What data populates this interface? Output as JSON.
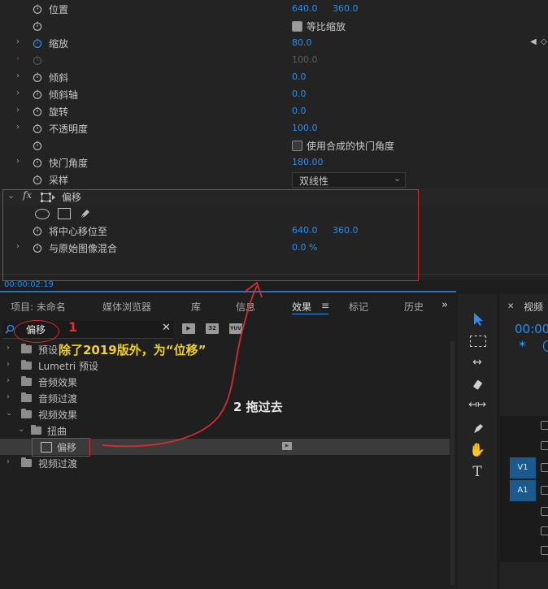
{
  "effect_controls": {
    "params": [
      {
        "name": "位置",
        "v1": "640.0",
        "v2": "360.0"
      },
      {
        "checkbox_label": "等比缩放"
      },
      {
        "name": "缩放",
        "v1": "80.0"
      },
      {
        "v1": "100.0"
      },
      {
        "name": "倾斜",
        "v1": "0.0"
      },
      {
        "name": "倾斜轴",
        "v1": "0.0"
      },
      {
        "name": "旋转",
        "v1": "0.0"
      },
      {
        "name": "不透明度",
        "v1": "100.0"
      },
      {
        "checkbox_label": "使用合成的快门角度"
      },
      {
        "name": "快门角度",
        "v1": "180.00"
      },
      {
        "name": "采样",
        "select_value": "双线性"
      }
    ],
    "offset_effect": {
      "fx_label": "fx",
      "name": "偏移",
      "params": [
        {
          "name": "将中心移位至",
          "v1": "640.0",
          "v2": "360.0"
        },
        {
          "name": "与原始图像混合",
          "v1": "0.0 %"
        }
      ]
    },
    "timecode": "00:00:02:19"
  },
  "effects_panel": {
    "tabs": [
      "项目: 未命名",
      "媒体浏览器",
      "库",
      "信息",
      "效果",
      "标记",
      "历史"
    ],
    "overflow": "»",
    "search_value": "偏移",
    "badges": [
      "32",
      "YUV"
    ],
    "tree": [
      {
        "label": "预设"
      },
      {
        "label": "Lumetri 预设"
      },
      {
        "label": "音频效果"
      },
      {
        "label": "音频过渡"
      },
      {
        "label": "视频效果"
      },
      {
        "label": "扭曲"
      },
      {
        "label": "偏移"
      },
      {
        "label": "视频过渡"
      }
    ]
  },
  "timeline": {
    "tab_label": "视频",
    "timecode": "00:00",
    "tracks": [
      "V1",
      "A1"
    ]
  },
  "annotations": {
    "step1": "1",
    "note": "除了2019版外，为“位移”",
    "step2": "2  拖过去"
  },
  "colors": {
    "accent": "#2d8ceb",
    "annotation": "#d42d2d",
    "note": "#f2d21b"
  }
}
